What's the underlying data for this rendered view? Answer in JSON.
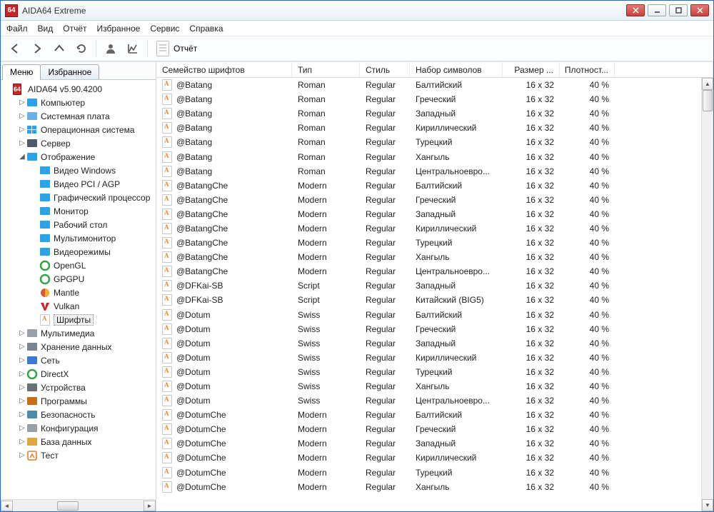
{
  "title": "AIDA64 Extreme",
  "app_icon": "64",
  "menu": [
    "Файл",
    "Вид",
    "Отчёт",
    "Избранное",
    "Сервис",
    "Справка"
  ],
  "toolbar_report": "Отчёт",
  "tabs": {
    "menu": "Меню",
    "fav": "Избранное"
  },
  "tree": [
    {
      "d": 0,
      "t": "AIDA64 v5.90.4200",
      "i": "app",
      "tw": ""
    },
    {
      "d": 1,
      "t": "Компьютер",
      "i": "pc",
      "tw": "▷"
    },
    {
      "d": 1,
      "t": "Системная плата",
      "i": "mb",
      "tw": "▷"
    },
    {
      "d": 1,
      "t": "Операционная система",
      "i": "win",
      "tw": "▷"
    },
    {
      "d": 1,
      "t": "Сервер",
      "i": "srv",
      "tw": "▷"
    },
    {
      "d": 1,
      "t": "Отображение",
      "i": "disp",
      "tw": "◢"
    },
    {
      "d": 2,
      "t": "Видео Windows",
      "i": "mon",
      "tw": ""
    },
    {
      "d": 2,
      "t": "Видео PCI / AGP",
      "i": "mon",
      "tw": ""
    },
    {
      "d": 2,
      "t": "Графический процессор",
      "i": "mon",
      "tw": ""
    },
    {
      "d": 2,
      "t": "Монитор",
      "i": "mon",
      "tw": ""
    },
    {
      "d": 2,
      "t": "Рабочий стол",
      "i": "mon",
      "tw": ""
    },
    {
      "d": 2,
      "t": "Мультимонитор",
      "i": "mon",
      "tw": ""
    },
    {
      "d": 2,
      "t": "Видеорежимы",
      "i": "mon",
      "tw": ""
    },
    {
      "d": 2,
      "t": "OpenGL",
      "i": "ogl",
      "tw": ""
    },
    {
      "d": 2,
      "t": "GPGPU",
      "i": "ogl",
      "tw": ""
    },
    {
      "d": 2,
      "t": "Mantle",
      "i": "mtl",
      "tw": ""
    },
    {
      "d": 2,
      "t": "Vulkan",
      "i": "vk",
      "tw": ""
    },
    {
      "d": 2,
      "t": "Шрифты",
      "i": "font",
      "tw": "",
      "sel": true
    },
    {
      "d": 1,
      "t": "Мультимедиа",
      "i": "mm",
      "tw": "▷"
    },
    {
      "d": 1,
      "t": "Хранение данных",
      "i": "hdd",
      "tw": "▷"
    },
    {
      "d": 1,
      "t": "Сеть",
      "i": "net",
      "tw": "▷"
    },
    {
      "d": 1,
      "t": "DirectX",
      "i": "dx",
      "tw": "▷"
    },
    {
      "d": 1,
      "t": "Устройства",
      "i": "dev",
      "tw": "▷"
    },
    {
      "d": 1,
      "t": "Программы",
      "i": "prg",
      "tw": "▷"
    },
    {
      "d": 1,
      "t": "Безопасность",
      "i": "sec",
      "tw": "▷"
    },
    {
      "d": 1,
      "t": "Конфигурация",
      "i": "cfg",
      "tw": "▷"
    },
    {
      "d": 1,
      "t": "База данных",
      "i": "db",
      "tw": "▷"
    },
    {
      "d": 1,
      "t": "Тест",
      "i": "bench",
      "tw": "▷"
    }
  ],
  "columns": [
    "Семейство шрифтов",
    "Тип",
    "Стиль",
    "Набор символов",
    "Размер ...",
    "Плотност..."
  ],
  "rows": [
    [
      "@Batang",
      "Roman",
      "Regular",
      "Балтийский",
      "16 x 32",
      "40 %"
    ],
    [
      "@Batang",
      "Roman",
      "Regular",
      "Греческий",
      "16 x 32",
      "40 %"
    ],
    [
      "@Batang",
      "Roman",
      "Regular",
      "Западный",
      "16 x 32",
      "40 %"
    ],
    [
      "@Batang",
      "Roman",
      "Regular",
      "Кириллический",
      "16 x 32",
      "40 %"
    ],
    [
      "@Batang",
      "Roman",
      "Regular",
      "Турецкий",
      "16 x 32",
      "40 %"
    ],
    [
      "@Batang",
      "Roman",
      "Regular",
      "Хангыль",
      "16 x 32",
      "40 %"
    ],
    [
      "@Batang",
      "Roman",
      "Regular",
      "Центральноевро...",
      "16 x 32",
      "40 %"
    ],
    [
      "@BatangChe",
      "Modern",
      "Regular",
      "Балтийский",
      "16 x 32",
      "40 %"
    ],
    [
      "@BatangChe",
      "Modern",
      "Regular",
      "Греческий",
      "16 x 32",
      "40 %"
    ],
    [
      "@BatangChe",
      "Modern",
      "Regular",
      "Западный",
      "16 x 32",
      "40 %"
    ],
    [
      "@BatangChe",
      "Modern",
      "Regular",
      "Кириллический",
      "16 x 32",
      "40 %"
    ],
    [
      "@BatangChe",
      "Modern",
      "Regular",
      "Турецкий",
      "16 x 32",
      "40 %"
    ],
    [
      "@BatangChe",
      "Modern",
      "Regular",
      "Хангыль",
      "16 x 32",
      "40 %"
    ],
    [
      "@BatangChe",
      "Modern",
      "Regular",
      "Центральноевро...",
      "16 x 32",
      "40 %"
    ],
    [
      "@DFKai-SB",
      "Script",
      "Regular",
      "Западный",
      "16 x 32",
      "40 %"
    ],
    [
      "@DFKai-SB",
      "Script",
      "Regular",
      "Китайский (BIG5)",
      "16 x 32",
      "40 %"
    ],
    [
      "@Dotum",
      "Swiss",
      "Regular",
      "Балтийский",
      "16 x 32",
      "40 %"
    ],
    [
      "@Dotum",
      "Swiss",
      "Regular",
      "Греческий",
      "16 x 32",
      "40 %"
    ],
    [
      "@Dotum",
      "Swiss",
      "Regular",
      "Западный",
      "16 x 32",
      "40 %"
    ],
    [
      "@Dotum",
      "Swiss",
      "Regular",
      "Кириллический",
      "16 x 32",
      "40 %"
    ],
    [
      "@Dotum",
      "Swiss",
      "Regular",
      "Турецкий",
      "16 x 32",
      "40 %"
    ],
    [
      "@Dotum",
      "Swiss",
      "Regular",
      "Хангыль",
      "16 x 32",
      "40 %"
    ],
    [
      "@Dotum",
      "Swiss",
      "Regular",
      "Центральноевро...",
      "16 x 32",
      "40 %"
    ],
    [
      "@DotumChe",
      "Modern",
      "Regular",
      "Балтийский",
      "16 x 32",
      "40 %"
    ],
    [
      "@DotumChe",
      "Modern",
      "Regular",
      "Греческий",
      "16 x 32",
      "40 %"
    ],
    [
      "@DotumChe",
      "Modern",
      "Regular",
      "Западный",
      "16 x 32",
      "40 %"
    ],
    [
      "@DotumChe",
      "Modern",
      "Regular",
      "Кириллический",
      "16 x 32",
      "40 %"
    ],
    [
      "@DotumChe",
      "Modern",
      "Regular",
      "Турецкий",
      "16 x 32",
      "40 %"
    ],
    [
      "@DotumChe",
      "Modern",
      "Regular",
      "Хангыль",
      "16 x 32",
      "40 %"
    ]
  ],
  "icon_colors": {
    "pc": "#2aa3e8",
    "mb": "#6db0e8",
    "win": "#1f8bea",
    "srv": "#4c5b6a",
    "disp": "#2aa3e8",
    "mon": "#2aa3e8",
    "ogl": "#35a448",
    "mtl": "#d85a24",
    "vk": "#d85a24",
    "font": "#df8a2e",
    "mm": "#9aa0a8",
    "hdd": "#7b858f",
    "net": "#3c78d8",
    "dx": "#35a448",
    "dev": "#6a7078",
    "prg": "#c76d18",
    "sec": "#4c8caa",
    "cfg": "#9aa0a8",
    "db": "#e0a63a",
    "bench": "#e07c2e"
  }
}
